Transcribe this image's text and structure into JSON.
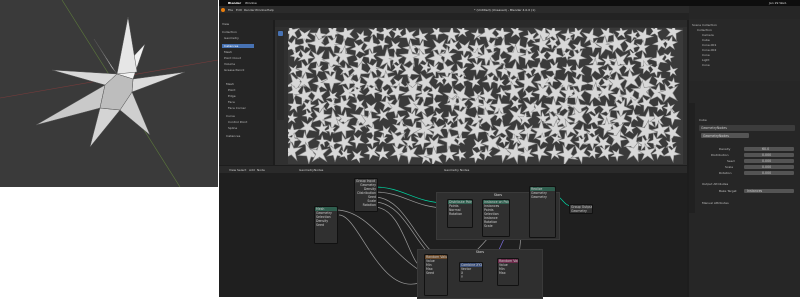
{
  "macos_menu": {
    "apple": "",
    "app": "Blender",
    "window": "Window",
    "clock": "Jan 29 Wed."
  },
  "window_title": "* (Untitled) (Unsaved) - Blender 4.0.0 (1)",
  "menus": [
    "File",
    "Edit",
    "Render",
    "Window",
    "Help"
  ],
  "workspace_tabs": [
    "Layout",
    "Modeling",
    "Sculpting",
    "UV Editing",
    "Texture Paint",
    "Shading",
    "Animation",
    "Rendering",
    "Compositing",
    "Geometry Nodes",
    "Scripting"
  ],
  "active_workspace_index": 9,
  "scene_label": "Scene",
  "view_layer_label": "ViewLayer",
  "left_panel": {
    "header": "View",
    "items": [
      "Collection",
      "Geometry",
      "Instances",
      "Mesh",
      "Point Cloud",
      "Volume",
      "Grease Pencil"
    ],
    "selected_index": 2,
    "footer": [
      "Mesh",
      "Point",
      "Edge",
      "Face",
      "Face Corner",
      "Curve",
      "Control Point",
      "Spline",
      "Instances"
    ]
  },
  "outliner": {
    "header": "Scene Collection",
    "items": [
      {
        "label": "Collection",
        "indent": 1
      },
      {
        "label": "Camera",
        "indent": 2
      },
      {
        "label": "Cube",
        "indent": 2
      },
      {
        "label": "Cone.001",
        "indent": 2
      },
      {
        "label": "Cone.002",
        "indent": 2
      },
      {
        "label": "Cone",
        "indent": 2
      },
      {
        "label": "Light",
        "indent": 2
      },
      {
        "label": "Cone",
        "indent": 2
      }
    ]
  },
  "properties": {
    "object_name": "Cube",
    "modifier_tab": "GeometryNodes",
    "node_group": "GeometryNodes",
    "fields": [
      {
        "label": "Density",
        "value": "60.0"
      },
      {
        "label": "Distribution",
        "value": "0.000"
      },
      {
        "label": "Seed",
        "value": "0.000"
      },
      {
        "label": "Scale",
        "value": "0.000"
      },
      {
        "label": "Rotation",
        "value": "0.000"
      }
    ],
    "section_2": [
      "Output Attributes",
      "Manual Attributes"
    ],
    "bake_target": "Instances",
    "bake_path": ""
  },
  "node_editor": {
    "header_items": [
      "View",
      "Select",
      "Add",
      "Node"
    ],
    "node_group": "GeometryNodes",
    "pin_label": "Geometry Nodes",
    "frames": [
      "Stars",
      "Stars"
    ],
    "nodes": [
      {
        "title": "Group Input",
        "color": "#3c3c3c",
        "rows": [
          "Geometry",
          "Density",
          "Distribution",
          "Seed",
          "Scale",
          "Rotation"
        ]
      },
      {
        "title": "Mesh",
        "color": "#2f5f4f",
        "rows": [
          "Geometry",
          "Selection",
          "Density",
          "Seed"
        ]
      },
      {
        "title": "Distribute Points",
        "color": "#2f5f4f",
        "rows": [
          "Points",
          "Normal",
          "Rotation"
        ]
      },
      {
        "title": "Instance on Points",
        "color": "#2f5f4f",
        "rows": [
          "Instances",
          "Points",
          "Selection",
          "Instance",
          "Rotation",
          "Scale"
        ]
      },
      {
        "title": "Realize",
        "color": "#2f5f4f",
        "rows": [
          "Geometry",
          "Geometry"
        ]
      },
      {
        "title": "Group Output",
        "color": "#3c3c3c",
        "rows": [
          "Geometry"
        ]
      },
      {
        "title": "Random Value",
        "color": "#6b4a2a",
        "rows": [
          "Value",
          "Min",
          "Max",
          "Seed"
        ]
      },
      {
        "title": "Combine XYZ",
        "color": "#3b4f79",
        "rows": [
          "Vector",
          "X",
          "Y",
          "Z"
        ]
      },
      {
        "title": "Random Value",
        "color": "#6b2a4a",
        "rows": [
          "Value",
          "Min",
          "Max"
        ]
      }
    ]
  },
  "colors": {
    "accent": "#4772b3",
    "geometry_socket": "#00d6a3",
    "node_green": "#2f5f4f"
  }
}
